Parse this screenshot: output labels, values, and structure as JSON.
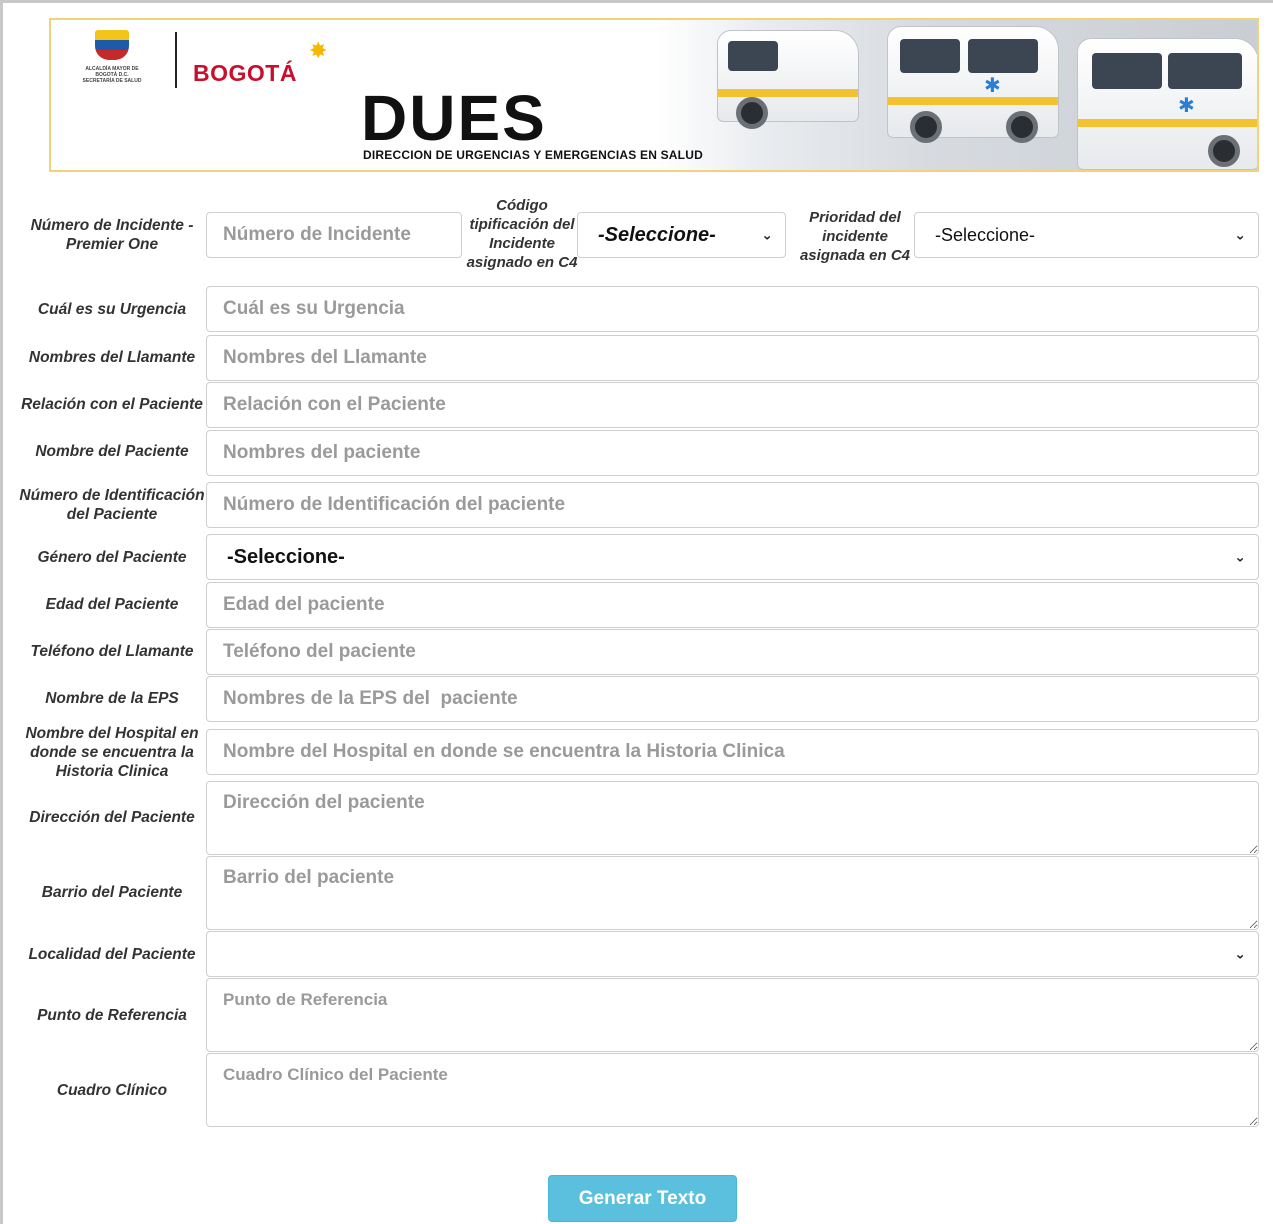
{
  "header": {
    "seal_text": "Alcaldía Mayor de Bogotá D.C. Secretaría de Salud",
    "city_logo": "BOGOTÁ",
    "title": "DUES",
    "subtitle": "DIRECCION DE URGENCIAS Y EMERGENCIAS EN SALUD"
  },
  "form": {
    "incident_label": "Número de Incidente - Premier One",
    "incident_placeholder": "Número de Incidente",
    "codigo_label": "Código tipificación del Incidente asignado en C4",
    "codigo_value": "-Seleccione-",
    "prioridad_label": "Prioridad del incidente asignada en C4",
    "prioridad_value": "-Seleccione-",
    "urgencia_label": "Cuál es su Urgencia",
    "urgencia_placeholder": "Cuál es su Urgencia",
    "llamante_label": "Nombres del Llamante",
    "llamante_placeholder": "Nombres del Llamante",
    "relacion_label": "Relación con el Paciente",
    "relacion_placeholder": "Relación con el Paciente",
    "paciente_label": "Nombre del Paciente",
    "paciente_placeholder": "Nombres del paciente",
    "identificacion_label": "Número de Identificación del Paciente",
    "identificacion_placeholder": "Número de Identificación del paciente",
    "genero_label": "Género del Paciente",
    "genero_value": "-Seleccione-",
    "edad_label": "Edad del Paciente",
    "edad_placeholder": "Edad del paciente",
    "telefono_label": "Teléfono del Llamante",
    "telefono_placeholder": "Teléfono del paciente",
    "eps_label": "Nombre de la EPS",
    "eps_placeholder": "Nombres de la EPS del  paciente",
    "hospital_label": "Nombre del Hospital en donde se encuentra la Historia Clinica",
    "hospital_placeholder": "Nombre del Hospital en donde se encuentra la Historia Clinica",
    "direccion_label": "Dirección del Paciente",
    "direccion_placeholder": "Dirección del paciente",
    "barrio_label": "Barrio del Paciente",
    "barrio_placeholder": "Barrio del paciente",
    "localidad_label": "Localidad del Paciente",
    "localidad_value": "",
    "referencia_label": "Punto de Referencia",
    "referencia_placeholder": "Punto de Referencia",
    "cuadro_label": "Cuadro Clínico",
    "cuadro_placeholder": "Cuadro Clínico del Paciente",
    "submit_label": "Generar Texto"
  },
  "icons": {
    "dropdown": "chevron-down-icon"
  },
  "colors": {
    "button": "#5bc0de",
    "banner_border": "#f2d27a",
    "logo_red": "#c8102e"
  }
}
